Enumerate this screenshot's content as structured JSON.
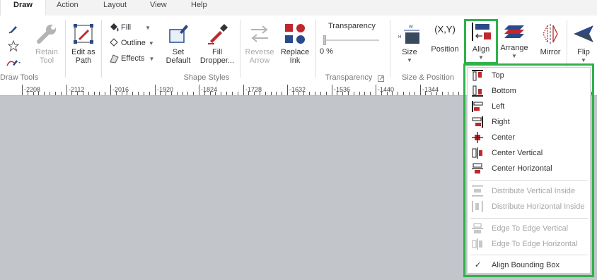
{
  "tabs": [
    "Draw",
    "Action",
    "Layout",
    "View",
    "Help"
  ],
  "draw_tools": {
    "retain_tool": [
      "Retain",
      "Tool"
    ],
    "group_label": "Draw Tools"
  },
  "shape_styles": {
    "edit_as_path": [
      "Edit as",
      "Path"
    ],
    "fill": "Fill",
    "outline": "Outline",
    "effects": "Effects",
    "set_default": [
      "Set",
      "Default"
    ],
    "fill_dropper": [
      "Fill",
      "Dropper..."
    ],
    "reverse_arrow": [
      "Reverse",
      "Arrow"
    ],
    "replace_ink": [
      "Replace",
      "Ink"
    ],
    "group_label": "Shape Styles"
  },
  "transparency": {
    "title": "Transparency",
    "value": "0 %",
    "group_label": "Transparency"
  },
  "size_position": {
    "size": "Size",
    "position": "Position",
    "position_glyph": "(X,Y)",
    "group_label": "Size & Position"
  },
  "arrange_group": {
    "align": "Align",
    "arrange": "Arrange",
    "mirror": "Mirror",
    "flip": "Flip"
  },
  "ruler": [
    "-2208",
    "-2112",
    "-2016",
    "-1920",
    "-1824",
    "-1728",
    "-1632",
    "-1536",
    "-1440",
    "-1344"
  ],
  "align_menu": {
    "items": [
      {
        "label": "Top"
      },
      {
        "label": "Bottom"
      },
      {
        "label": "Left"
      },
      {
        "label": "Right"
      },
      {
        "label": "Center"
      },
      {
        "label": "Center Vertical"
      },
      {
        "label": "Center Horizontal"
      },
      {
        "label": "Distribute Vertical Inside"
      },
      {
        "label": "Distribute Horizontal Inside"
      },
      {
        "label": "Edge To Edge Vertical"
      },
      {
        "label": "Edge To Edge Horizontal"
      },
      {
        "label": "Align Bounding Box"
      }
    ],
    "check_glyph": "✓"
  },
  "colors": {
    "accent_red": "#c0282e",
    "accent_blue": "#2a4a8a",
    "highlight_green": "#2fb24a"
  }
}
